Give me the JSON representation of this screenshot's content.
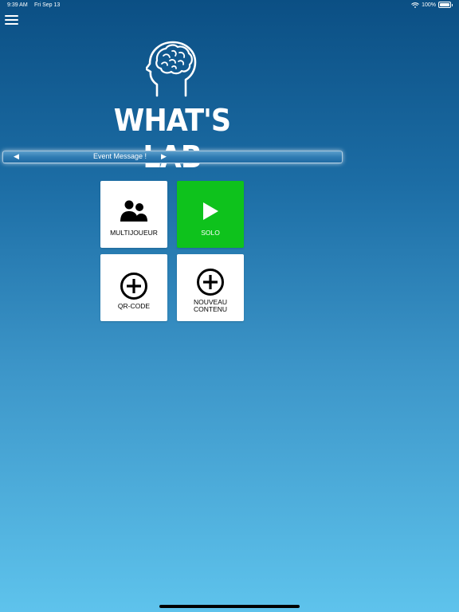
{
  "status_bar": {
    "time": "9:39 AM",
    "date": "Fri Sep 13",
    "battery": "100%",
    "icons": [
      "wifi-icon",
      "battery-icon"
    ]
  },
  "header": {
    "menu_icon": "hamburger-menu-icon",
    "logo_icon": "brain-head-icon",
    "title": "WHAT'S LAB"
  },
  "event_bar": {
    "prev": "◀",
    "message": "Event Message !",
    "next": "▶"
  },
  "tiles": [
    {
      "label": "MULTIJOUEUR",
      "icon": "users-icon",
      "background": "#ffffff"
    },
    {
      "label": "SOLO",
      "icon": "play-icon",
      "background": "#0ec21c"
    },
    {
      "label": "QR-CODE",
      "icon": "add-circle-icon",
      "background": "#ffffff"
    },
    {
      "label_line1": "NOUVEAU",
      "label_line2": "CONTENU",
      "icon": "add-circle-icon",
      "background": "#ffffff"
    }
  ],
  "colors": {
    "background_top": "#0b4f84",
    "background_bottom": "#5ec3ec",
    "solo_green": "#0ec21c"
  }
}
